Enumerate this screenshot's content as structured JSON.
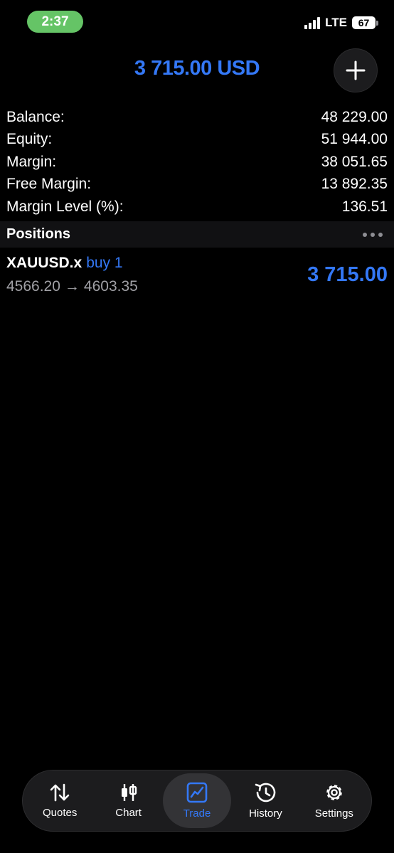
{
  "status_bar": {
    "time": "2:37",
    "network": "LTE",
    "battery": "67"
  },
  "header": {
    "title": "3 715.00 USD",
    "add_icon": "plus-icon"
  },
  "summary": [
    {
      "label": "Balance:",
      "value": "48 229.00"
    },
    {
      "label": "Equity:",
      "value": "51 944.00"
    },
    {
      "label": "Margin:",
      "value": "38 051.65"
    },
    {
      "label": "Free Margin:",
      "value": "13 892.35"
    },
    {
      "label": "Margin Level (%):",
      "value": "136.51"
    }
  ],
  "positions": {
    "title": "Positions",
    "items": [
      {
        "symbol": "XAUUSD.x",
        "side": "buy 1",
        "open_price": "4566.20",
        "arrow": "→",
        "current_price": "4603.35",
        "profit": "3 715.00"
      }
    ]
  },
  "tabs": [
    {
      "label": "Quotes",
      "icon": "arrows-updown-icon",
      "active": false
    },
    {
      "label": "Chart",
      "icon": "candlestick-icon",
      "active": false
    },
    {
      "label": "Trade",
      "icon": "trade-chart-icon",
      "active": true
    },
    {
      "label": "History",
      "icon": "history-clock-icon",
      "active": false
    },
    {
      "label": "Settings",
      "icon": "gear-icon",
      "active": false
    }
  ],
  "colors": {
    "accent": "#3478f6",
    "background": "#000000",
    "time_pill": "#65c466"
  }
}
